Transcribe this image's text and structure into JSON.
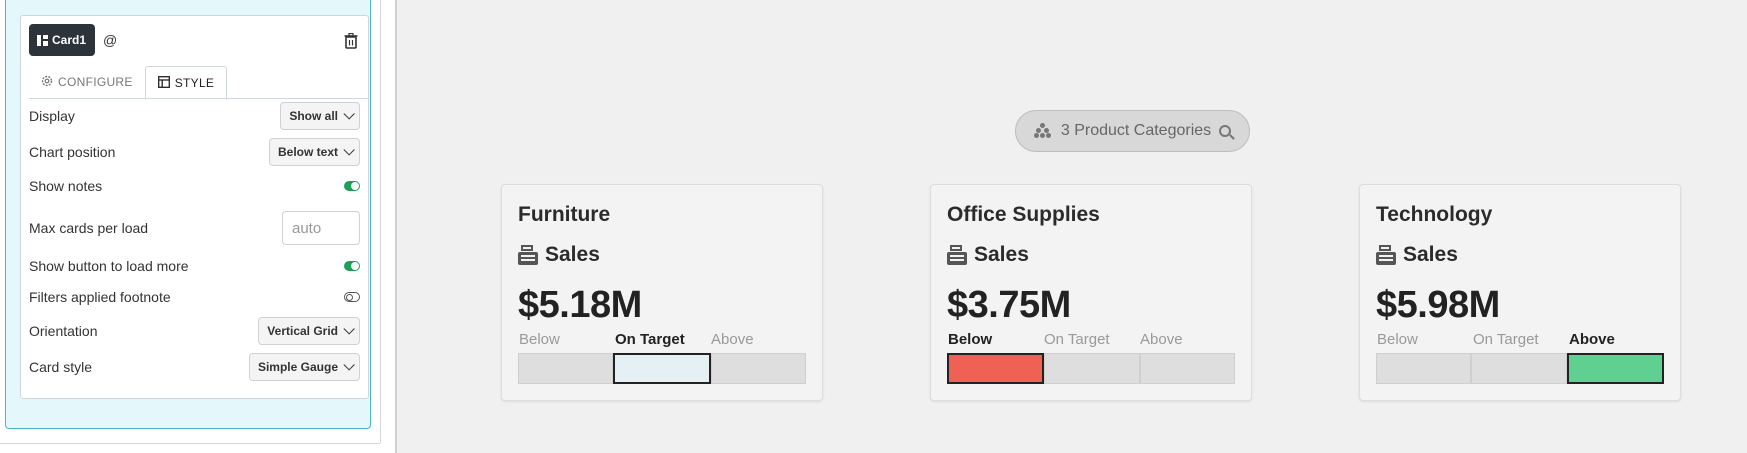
{
  "left_panel": {
    "card_chip": "Card1",
    "at_symbol": "@",
    "tabs": [
      {
        "label": "CONFIGURE",
        "icon": "gear-icon",
        "active": false
      },
      {
        "label": "STYLE",
        "icon": "layout-icon",
        "active": true
      }
    ],
    "settings": {
      "display": {
        "label": "Display",
        "value": "Show all"
      },
      "chart_position": {
        "label": "Chart position",
        "value": "Below text"
      },
      "show_notes": {
        "label": "Show notes",
        "state": "on"
      },
      "max_cards": {
        "label": "Max cards per load",
        "placeholder": "auto"
      },
      "load_more": {
        "label": "Show button to load more",
        "state": "on"
      },
      "filters_footnote": {
        "label": "Filters applied footnote",
        "state": "off"
      },
      "orientation": {
        "label": "Orientation",
        "value": "Vertical Grid"
      },
      "card_style": {
        "label": "Card style",
        "value": "Simple Gauge"
      }
    }
  },
  "main": {
    "category_pill": "3 Product Categories",
    "gauge_labels": [
      "Below",
      "On Target",
      "Above"
    ],
    "colors": {
      "below": "#ef6155",
      "on_target": "#e4f0f3",
      "above": "#5fd08f",
      "toggle_on": "#1e9e57"
    },
    "cards": [
      {
        "title": "Furniture",
        "metric": "Sales",
        "value": "$5.18M",
        "status": "On Target"
      },
      {
        "title": "Office Supplies",
        "metric": "Sales",
        "value": "$3.75M",
        "status": "Below"
      },
      {
        "title": "Technology",
        "metric": "Sales",
        "value": "$5.98M",
        "status": "Above"
      }
    ]
  }
}
